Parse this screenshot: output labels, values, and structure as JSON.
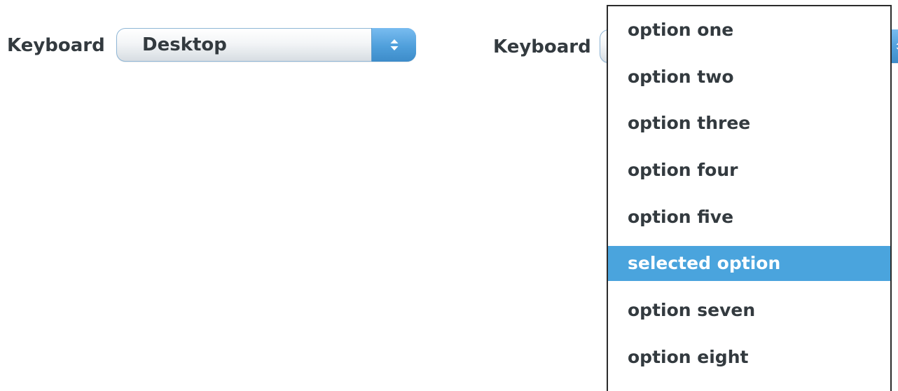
{
  "left_field": {
    "label": "Keyboard",
    "value": "Desktop",
    "arrow_icon": "updown-chevron-icon"
  },
  "right_field": {
    "label": "Keyboard",
    "arrow_icon": "updown-chevron-icon"
  },
  "popup": {
    "options": [
      {
        "label": "option one",
        "selected": false
      },
      {
        "label": "option two",
        "selected": false
      },
      {
        "label": "option three",
        "selected": false
      },
      {
        "label": "option four",
        "selected": false
      },
      {
        "label": "option five",
        "selected": false
      },
      {
        "label": "selected option",
        "selected": true
      },
      {
        "label": "option seven",
        "selected": false
      },
      {
        "label": "option eight",
        "selected": false
      }
    ]
  },
  "colors": {
    "accent": "#4aa4dd",
    "text": "#333a3f",
    "border": "#8fb6d6"
  }
}
